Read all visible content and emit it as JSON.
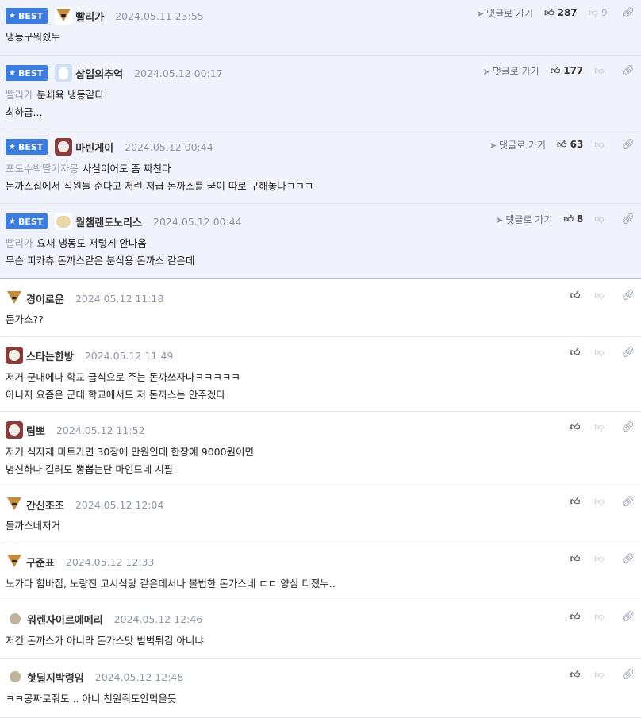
{
  "best_label": "BEST",
  "goto_label": "댓글로 가기",
  "best_comments": [
    {
      "nick": "빨리가",
      "date": "2024.05.11 23:55",
      "up": "287",
      "down": "9",
      "avatar": "fox",
      "ref": "",
      "lines": [
        "냉동구워줬누"
      ]
    },
    {
      "nick": "삽입의추억",
      "date": "2024.05.12 00:17",
      "up": "177",
      "down": "",
      "avatar": "blue",
      "ref": "빨리가",
      "lines": [
        "분쇄육 냉동같다",
        "최하급..."
      ]
    },
    {
      "nick": "마빈게이",
      "date": "2024.05.12 00:44",
      "up": "63",
      "down": "",
      "avatar": "dog",
      "ref": "포도수박딸기자몽",
      "lines": [
        "사실이어도 좀 짜친다",
        "돈까스집에서 직원들 준다고 저런 저급 돈까스를 굳이 따로 구해놓나ㅋㅋㅋ"
      ]
    },
    {
      "nick": "월챔랜도노리스",
      "date": "2024.05.12 00:44",
      "up": "8",
      "down": "",
      "avatar": "pup",
      "ref": "빨리가",
      "lines": [
        "요새 냉동도 저렇게 안나옴",
        "무슨 피카츄 돈까스같은 분식용 돈까스 같은데"
      ]
    }
  ],
  "comments": [
    {
      "nick": "경이로운",
      "date": "2024.05.12 11:18",
      "avatar": "fox",
      "lines": [
        "돈가스??"
      ]
    },
    {
      "nick": "스타는한방",
      "date": "2024.05.12 11:49",
      "avatar": "dog",
      "lines": [
        "저거 군대에나 학교 급식으로 주는 돈까쓰자나ㅋㅋㅋㅋㅋ",
        "아니지 요즘은 군대 학교에서도 저 돈까스는 안주겠다"
      ]
    },
    {
      "nick": "림뽀",
      "date": "2024.05.12 11:52",
      "avatar": "dog",
      "lines": [
        "저거 식자재 마트가면 30장에 만원인데 한장에 9000원이면",
        "병신하나 걸려도 뽕뽑는단 마인드네 시팔"
      ]
    },
    {
      "nick": "간신조조",
      "date": "2024.05.12 12:04",
      "avatar": "fox",
      "lines": [
        "돌까스네저거"
      ]
    },
    {
      "nick": "구준표",
      "date": "2024.05.12 12:33",
      "avatar": "fox",
      "lines": [
        "노가다 함바집, 노량진 고시식당 같은데서나 볼법한 돈가스네 ㄷㄷ 양심 디졌누.."
      ]
    },
    {
      "nick": "워렌자이르에메리",
      "date": "2024.05.12 12:46",
      "avatar": "dot",
      "lines": [
        "저건 돈까스가 아니라 돈가스맛 범벅튀김 아니냐"
      ]
    },
    {
      "nick": "핫딜지박령임",
      "date": "2024.05.12 12:48",
      "avatar": "dot",
      "lines": [
        "ㅋㅋ공짜로줘도 .. 아니 천원줘도안먹을듯"
      ]
    }
  ]
}
